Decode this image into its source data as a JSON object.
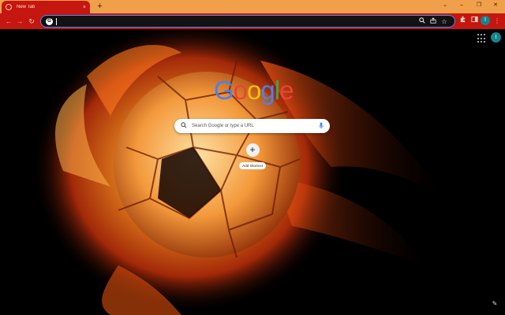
{
  "tab": {
    "title": "New Tab",
    "close": "×"
  },
  "tabstrip": {
    "new_tab": "+",
    "controls": [
      "⌄",
      "–",
      "❐",
      "✕"
    ]
  },
  "toolbar": {
    "back": "←",
    "forward": "→",
    "reload": "↻",
    "omnibox_value": "",
    "omnibox_icons": {
      "zoom": "🔍",
      "share": "⇪",
      "bookmark": "☆"
    },
    "extensions": "✦",
    "sidepanel": "▯",
    "profile_initial": "I",
    "menu": "⋮"
  },
  "ntp": {
    "account_initial": "I",
    "logo_letters": [
      {
        "ch": "G",
        "color": "#4285F4"
      },
      {
        "ch": "o",
        "color": "#EA4335"
      },
      {
        "ch": "o",
        "color": "#FBBC05"
      },
      {
        "ch": "g",
        "color": "#4285F4"
      },
      {
        "ch": "l",
        "color": "#34A853"
      },
      {
        "ch": "e",
        "color": "#EA4335"
      }
    ],
    "search_placeholder": "Search Google or type a URL",
    "add_shortcut_label": "Add shortcut",
    "add_shortcut_icon": "+",
    "customize_icon": "✎"
  },
  "colors": {
    "tabstrip": "#f0a04b",
    "toolbar": "#c5160f",
    "omnibox_border": "#4c8bf5",
    "profile": "#12868c"
  }
}
